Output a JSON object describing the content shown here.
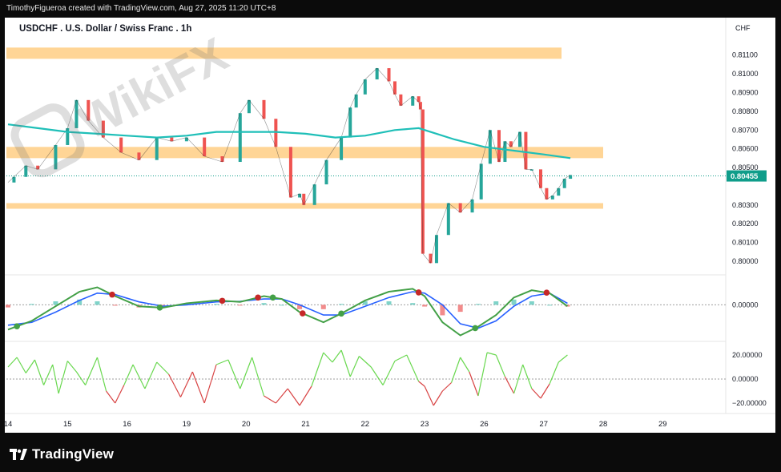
{
  "header": {
    "credit": "TimothyFigueroa created with TradingView.com, Aug 27, 2025 11:20 UTC+8"
  },
  "chart": {
    "title": "USDCHF . U.S. Dollar / Swiss Franc . 1h",
    "unit": "CHF",
    "current_price_label": "0.80455",
    "watermark": "WikiFX"
  },
  "footer": {
    "brand": "TradingView"
  },
  "colors": {
    "up": "#26a69a",
    "down": "#ef5350",
    "ma": "#1fbfb8",
    "zone": "#ffd596",
    "price_tag": "#0f9d8a"
  },
  "chart_data": [
    {
      "type": "line",
      "panel": "price",
      "y_ticks": [
        "0.81100",
        "0.81000",
        "0.80900",
        "0.80800",
        "0.80700",
        "0.80600",
        "0.80500",
        "0.80300",
        "0.80200",
        "0.80100",
        "0.80000"
      ],
      "y_tick_values": [
        0.811,
        0.81,
        0.809,
        0.808,
        0.807,
        0.806,
        0.805,
        0.803,
        0.802,
        0.801,
        0.8
      ],
      "ylim": [
        0.7994,
        0.8118
      ],
      "x_ticks": [
        "14",
        "15",
        "16",
        "19",
        "20",
        "21",
        "22",
        "23",
        "26",
        "27",
        "28",
        "29"
      ],
      "x_tick_values": [
        0,
        1,
        2,
        3,
        4,
        5,
        6,
        7,
        8,
        9,
        10,
        11
      ],
      "current_price": 0.80455,
      "series": [
        {
          "role": "price",
          "x": [
            0,
            0.1,
            0.3,
            0.5,
            0.8,
            1.0,
            1.15,
            1.35,
            1.6,
            1.9,
            2.2,
            2.5,
            2.75,
            3.0,
            3.3,
            3.6,
            3.9,
            4.05,
            4.3,
            4.5,
            4.75,
            4.9,
            4.97,
            5.15,
            5.35,
            5.6,
            5.75,
            5.85,
            6.0,
            6.2,
            6.4,
            6.5,
            6.6,
            6.8,
            6.9,
            6.93,
            6.97,
            7.1,
            7.2,
            7.4,
            7.6,
            7.8,
            7.95,
            8.1,
            8.25,
            8.35,
            8.45,
            8.6,
            8.7,
            8.8,
            8.95,
            9.05,
            9.15,
            9.25,
            9.35,
            9.45
          ],
          "y": [
            0.8042,
            0.8045,
            0.8051,
            0.8049,
            0.8062,
            0.8071,
            0.8086,
            0.8075,
            0.8066,
            0.8058,
            0.8054,
            0.8066,
            0.8064,
            0.8066,
            0.8056,
            0.8053,
            0.8079,
            0.8086,
            0.8076,
            0.8061,
            0.8034,
            0.8036,
            0.803,
            0.8041,
            0.8054,
            0.8066,
            0.8082,
            0.8089,
            0.8097,
            0.8103,
            0.8096,
            0.8089,
            0.8083,
            0.8088,
            0.8085,
            0.8081,
            0.8004,
            0.7999,
            0.8014,
            0.8031,
            0.8026,
            0.8033,
            0.8052,
            0.807,
            0.8053,
            0.8064,
            0.8061,
            0.8069,
            0.8049,
            0.8049,
            0.8039,
            0.8033,
            0.8035,
            0.8039,
            0.8044,
            0.8046
          ]
        },
        {
          "role": "moving-average",
          "x": [
            0,
            0.5,
            1.0,
            1.5,
            2.0,
            2.5,
            3.0,
            3.5,
            4.0,
            4.5,
            5.0,
            5.5,
            6.0,
            6.5,
            6.9,
            7.2,
            7.5,
            8.0,
            8.5,
            9.0,
            9.45
          ],
          "y": [
            0.8073,
            0.8071,
            0.8069,
            0.8068,
            0.8067,
            0.8066,
            0.8067,
            0.8069,
            0.8069,
            0.8069,
            0.8068,
            0.8066,
            0.8067,
            0.807,
            0.8071,
            0.8068,
            0.8065,
            0.8061,
            0.8059,
            0.8057,
            0.8055
          ]
        }
      ],
      "zones": [
        {
          "from": 0.8108,
          "to": 0.8114,
          "x_end": 9.3
        },
        {
          "from": 0.8055,
          "to": 0.8061,
          "x_end": 10.0
        },
        {
          "from": 0.8028,
          "to": 0.8031,
          "x_end": 10.0
        }
      ]
    },
    {
      "type": "line",
      "panel": "macd",
      "y_ticks": [
        "0.00000"
      ],
      "y_tick_values": [
        0
      ],
      "ylim": [
        -1.2,
        1.0
      ],
      "series": [
        {
          "role": "macd-line",
          "x": [
            0,
            0.4,
            0.8,
            1.2,
            1.5,
            1.8,
            2.2,
            2.6,
            3.0,
            3.5,
            3.9,
            4.3,
            4.6,
            4.9,
            5.3,
            5.6,
            6.0,
            6.4,
            6.8,
            7.0,
            7.3,
            7.6,
            7.9,
            8.2,
            8.5,
            8.8,
            9.1,
            9.4
          ],
          "y": [
            -0.85,
            -0.55,
            -0.05,
            0.45,
            0.6,
            0.3,
            -0.05,
            -0.1,
            0.05,
            0.15,
            0.1,
            0.3,
            0.2,
            -0.25,
            -0.6,
            -0.3,
            0.15,
            0.45,
            0.55,
            0.3,
            -0.6,
            -1.05,
            -0.75,
            -0.35,
            0.25,
            0.5,
            0.4,
            -0.05
          ]
        },
        {
          "role": "signal-line",
          "x": [
            0,
            0.4,
            0.8,
            1.2,
            1.5,
            1.8,
            2.2,
            2.6,
            3.0,
            3.5,
            3.9,
            4.3,
            4.6,
            4.9,
            5.3,
            5.6,
            6.0,
            6.4,
            6.8,
            7.0,
            7.3,
            7.6,
            7.9,
            8.2,
            8.5,
            8.8,
            9.1,
            9.4
          ],
          "y": [
            -0.7,
            -0.6,
            -0.25,
            0.15,
            0.4,
            0.35,
            0.1,
            -0.05,
            0.0,
            0.1,
            0.12,
            0.2,
            0.2,
            0.0,
            -0.35,
            -0.35,
            -0.05,
            0.25,
            0.45,
            0.4,
            0.0,
            -0.65,
            -0.8,
            -0.55,
            -0.05,
            0.3,
            0.4,
            0.05
          ]
        }
      ],
      "cross_markers": [
        {
          "x": 0.15,
          "type": "bullish"
        },
        {
          "x": 1.75,
          "type": "bearish"
        },
        {
          "x": 2.55,
          "type": "bullish"
        },
        {
          "x": 3.6,
          "type": "bearish"
        },
        {
          "x": 4.2,
          "type": "bearish"
        },
        {
          "x": 4.45,
          "type": "bullish"
        },
        {
          "x": 4.95,
          "type": "bearish"
        },
        {
          "x": 5.6,
          "type": "bullish"
        },
        {
          "x": 6.9,
          "type": "bearish"
        },
        {
          "x": 7.85,
          "type": "bullish"
        },
        {
          "x": 9.05,
          "type": "bearish"
        }
      ]
    },
    {
      "type": "line",
      "panel": "oscillator",
      "y_ticks": [
        "20.00000",
        "0.00000",
        "−20.00000"
      ],
      "y_tick_values": [
        20,
        0,
        -20
      ],
      "ylim": [
        -26,
        30
      ],
      "series": [
        {
          "role": "oscillator",
          "x": [
            0,
            0.15,
            0.3,
            0.45,
            0.6,
            0.75,
            0.85,
            1.0,
            1.15,
            1.3,
            1.5,
            1.65,
            1.8,
            1.95,
            2.1,
            2.3,
            2.5,
            2.7,
            2.9,
            3.1,
            3.3,
            3.5,
            3.7,
            3.9,
            4.1,
            4.3,
            4.5,
            4.7,
            4.9,
            5.1,
            5.3,
            5.45,
            5.6,
            5.75,
            5.9,
            6.1,
            6.3,
            6.5,
            6.7,
            6.9,
            7.0,
            7.15,
            7.3,
            7.45,
            7.6,
            7.75,
            7.9,
            8.05,
            8.2,
            8.35,
            8.5,
            8.65,
            8.8,
            8.95,
            9.1,
            9.25,
            9.4
          ],
          "y": [
            10,
            18,
            5,
            16,
            -5,
            12,
            -12,
            15,
            6,
            -5,
            18,
            -10,
            -20,
            -5,
            12,
            -8,
            14,
            4,
            -15,
            6,
            -20,
            12,
            16,
            -8,
            18,
            -14,
            -20,
            -8,
            -22,
            -6,
            22,
            14,
            24,
            2,
            19,
            10,
            -5,
            15,
            20,
            -2,
            -6,
            -22,
            -10,
            -3,
            18,
            6,
            -14,
            22,
            20,
            2,
            -12,
            12,
            -8,
            -16,
            -4,
            14,
            20
          ]
        }
      ]
    }
  ]
}
